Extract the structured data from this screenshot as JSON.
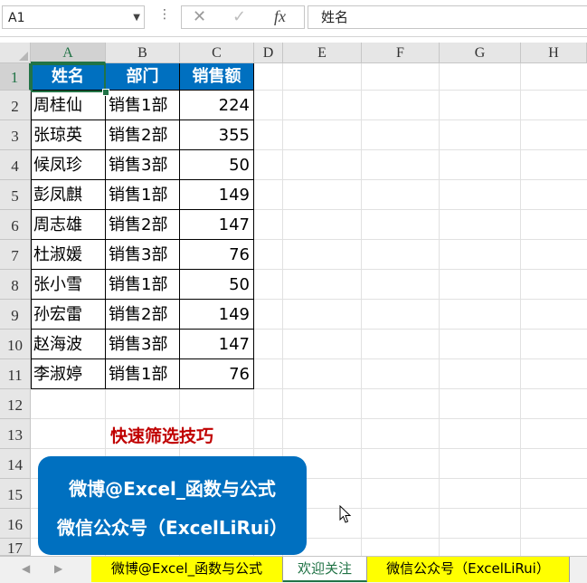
{
  "formula_bar": {
    "name_box": "A1",
    "cancel_icon": "✕",
    "enter_icon": "✓",
    "fx_label": "fx",
    "content": "姓名"
  },
  "columns": [
    "A",
    "B",
    "C",
    "D",
    "E",
    "F",
    "G",
    "H"
  ],
  "rows": [
    "1",
    "2",
    "3",
    "4",
    "5",
    "6",
    "7",
    "8",
    "9",
    "10",
    "11",
    "12",
    "13",
    "14",
    "15",
    "16",
    "17"
  ],
  "table": {
    "headers": [
      "姓名",
      "部门",
      "销售额"
    ],
    "records": [
      {
        "name": "周桂仙",
        "dept": "销售1部",
        "sales": "224"
      },
      {
        "name": "张琼英",
        "dept": "销售2部",
        "sales": "355"
      },
      {
        "name": "候凤珍",
        "dept": "销售3部",
        "sales": "50"
      },
      {
        "name": "彭凤麒",
        "dept": "销售1部",
        "sales": "149"
      },
      {
        "name": "周志雄",
        "dept": "销售2部",
        "sales": "147"
      },
      {
        "name": "杜淑媛",
        "dept": "销售3部",
        "sales": "76"
      },
      {
        "name": "张小雪",
        "dept": "销售1部",
        "sales": "50"
      },
      {
        "name": "孙宏雷",
        "dept": "销售2部",
        "sales": "149"
      },
      {
        "name": "赵海波",
        "dept": "销售3部",
        "sales": "147"
      },
      {
        "name": "李淑婷",
        "dept": "销售1部",
        "sales": "76"
      }
    ]
  },
  "caption": "快速筛选技巧",
  "promo": {
    "line1": "微博@Excel_函数与公式",
    "line2": "微信公众号（ExcelLiRui）"
  },
  "sheet_tabs": [
    "微博@Excel_函数与公式",
    "欢迎关注",
    "微信公众号（ExcelLiRui）"
  ],
  "colors": {
    "header_fill": "#0070c0",
    "caption": "#c00000",
    "tab_fill": "#ffff00",
    "selection": "#217346"
  }
}
